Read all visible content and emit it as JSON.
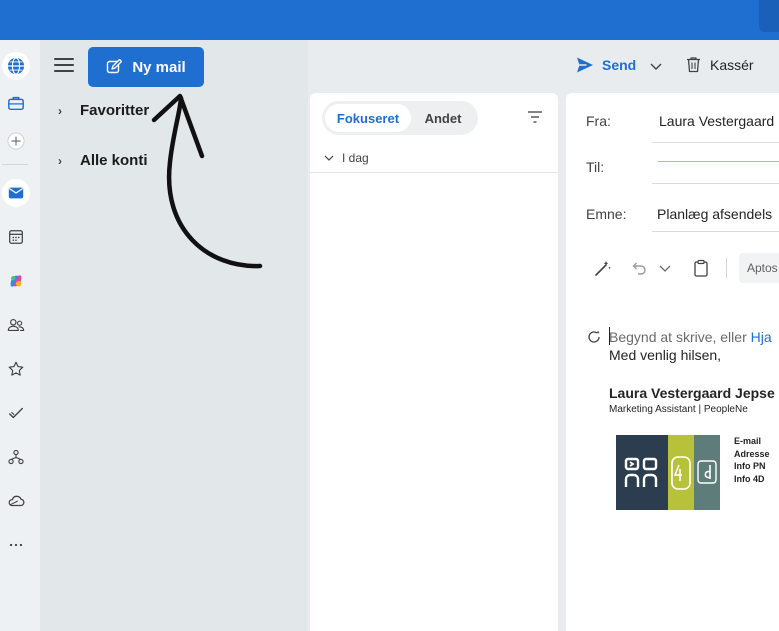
{
  "compose": {
    "send_label": "Send",
    "discard_label": "Kassér",
    "from_label": "Fra:",
    "from_value": "Laura Vestergaard",
    "to_label": "Til:",
    "subject_label": "Emne:",
    "subject_value": "Planlæg afsendels",
    "font_name": "Aptos",
    "placeholder_text": "Begynd at skrive, eller ",
    "placeholder_link": "Hja",
    "greeting": "Med venlig hilsen,",
    "signature": {
      "name": "Laura Vestergaard Jepse",
      "role": "Marketing Assistant  |  PeopleNe",
      "links": [
        "E-mail",
        "Adresse",
        "Info PN",
        "Info 4D"
      ],
      "logo_mid_text": "4d"
    }
  },
  "toolbar": {
    "new_mail_label": "Ny mail"
  },
  "folders": [
    {
      "label": "Favoritter"
    },
    {
      "label": "Alle konti"
    }
  ],
  "message_list": {
    "tabs": [
      {
        "label": "Fokuseret",
        "selected": true
      },
      {
        "label": "Andet",
        "selected": false
      }
    ],
    "group_label": "I dag"
  },
  "colors": {
    "brand": "#1f6fd1",
    "logo_dark": "#2c3d4f",
    "logo_lime": "#b8c13a",
    "logo_teal": "#5e7d7a"
  },
  "rail_icons": [
    "globe-icon",
    "briefcase-icon",
    "add-icon",
    "mail-icon",
    "calendar-icon",
    "copilot-icon",
    "people-icon",
    "favorites-icon",
    "todo-icon",
    "org-icon",
    "onedrive-icon",
    "more-icon"
  ]
}
